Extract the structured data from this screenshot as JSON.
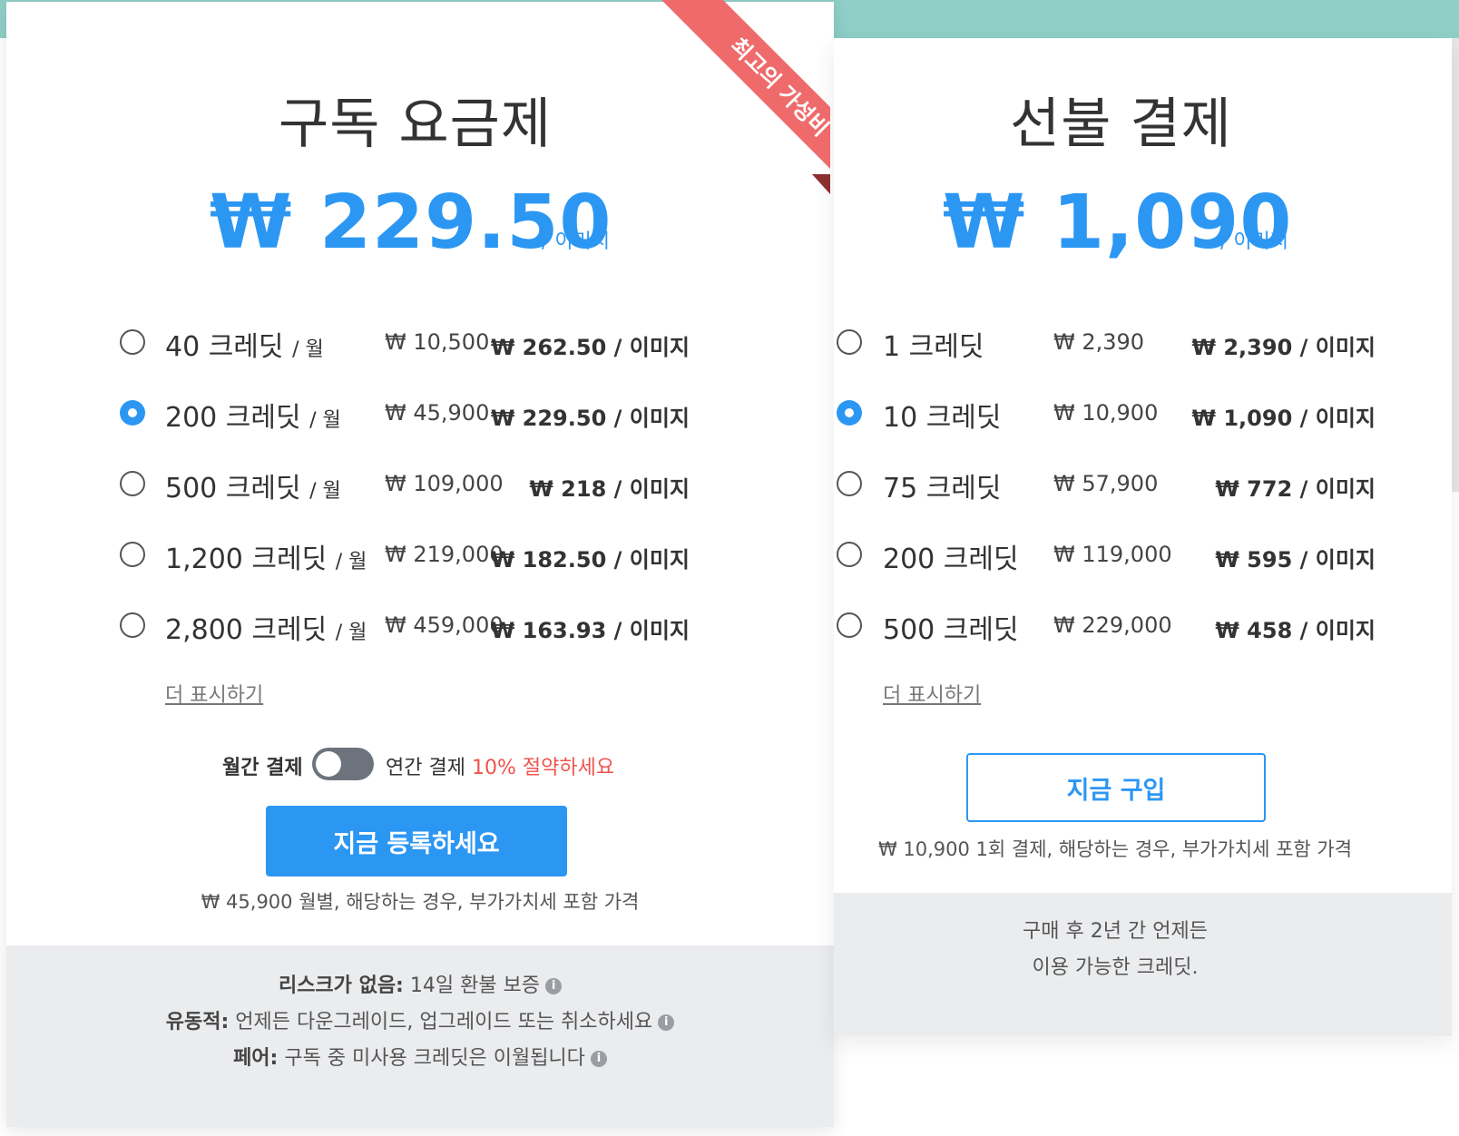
{
  "subscription": {
    "title": "구독 요금제",
    "price": "₩ 229.50",
    "per_unit": "/ 이미지",
    "ribbon": "최고의 가성비",
    "options": [
      {
        "credits": "40 크레딧",
        "unit": "/ 월",
        "amount": "₩ 10,500",
        "per_image": "₩ 262.50 / 이미지",
        "selected": false
      },
      {
        "credits": "200 크레딧",
        "unit": "/ 월",
        "amount": "₩ 45,900",
        "per_image": "₩ 229.50 / 이미지",
        "selected": true
      },
      {
        "credits": "500 크레딧",
        "unit": "/ 월",
        "amount": "₩ 109,000",
        "per_image": "₩ 218 / 이미지",
        "selected": false
      },
      {
        "credits": "1,200 크레딧",
        "unit": "/ 월",
        "amount": "₩ 219,000",
        "per_image": "₩ 182.50 / 이미지",
        "selected": false
      },
      {
        "credits": "2,800 크레딧",
        "unit": "/ 월",
        "amount": "₩ 459,000",
        "per_image": "₩ 163.93 / 이미지",
        "selected": false
      }
    ],
    "show_more": "더 표시하기",
    "toggle": {
      "monthly_label": "월간 결제",
      "annual_label": "연간 결제",
      "save_text": "10% 절약하세요",
      "is_annual": false
    },
    "cta": "지금 등록하세요",
    "note": "₩ 45,900 월별, 해당하는 경우, 부가가치세 포함 가격",
    "footer": [
      {
        "bold": "리스크가 없음:",
        "text": " 14일 환불 보증"
      },
      {
        "bold": "유동적:",
        "text": " 언제든 다운그레이드, 업그레이드 또는 취소하세요"
      },
      {
        "bold": "페어:",
        "text": " 구독 중 미사용 크레딧은 이월됩니다"
      }
    ]
  },
  "prepaid": {
    "title": "선불 결제",
    "price": "₩ 1,090",
    "per_unit": "/ 이미지",
    "options": [
      {
        "credits": "1 크레딧",
        "amount": "₩ 2,390",
        "per_image": "₩ 2,390 / 이미지",
        "selected": false
      },
      {
        "credits": "10 크레딧",
        "amount": "₩ 10,900",
        "per_image": "₩ 1,090 / 이미지",
        "selected": true
      },
      {
        "credits": "75 크레딧",
        "amount": "₩ 57,900",
        "per_image": "₩ 772 / 이미지",
        "selected": false
      },
      {
        "credits": "200 크레딧",
        "amount": "₩ 119,000",
        "per_image": "₩ 595 / 이미지",
        "selected": false
      },
      {
        "credits": "500 크레딧",
        "amount": "₩ 229,000",
        "per_image": "₩ 458 / 이미지",
        "selected": false
      }
    ],
    "show_more": "더 표시하기",
    "cta": "지금 구입",
    "note": "₩ 10,900 1회 결제, 해당하는 경우, 부가가치세 포함 가격",
    "footer_line1": "구매 후 2년 간 언제든",
    "footer_line2": "이용 가능한 크레딧."
  },
  "colors": {
    "accent": "#2c97f3",
    "ribbon": "#ef6b6b",
    "save": "#f0534e",
    "teal": "#8fcfc7",
    "footer_bg": "#ebecee"
  }
}
